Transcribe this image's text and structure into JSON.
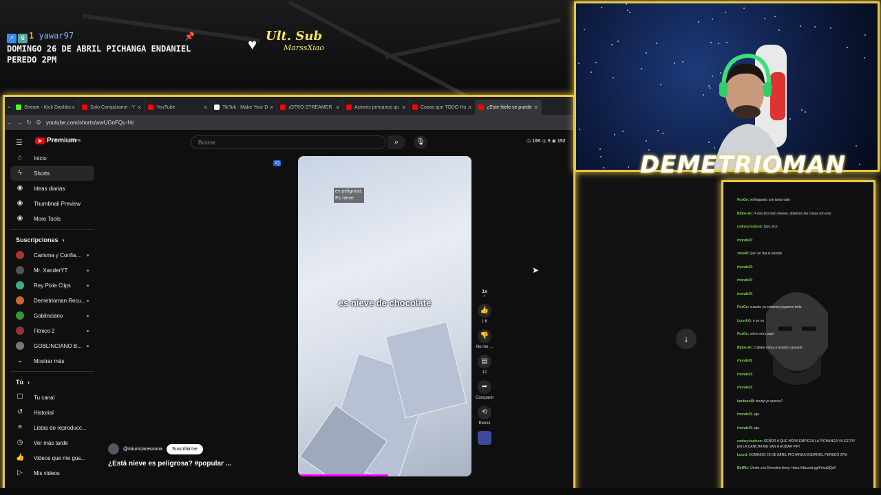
{
  "overlay": {
    "username": "yawar97",
    "badge_count": "1",
    "announcement": "DOMINGO 26 DE ABRIL PICHANGA ENDANIEL PEREDO 2PM",
    "ult_sub_label": "Ult. Sub",
    "ult_sub_name": "MarssXiao",
    "streamer_name": "DEMETRIOMAN"
  },
  "browser": {
    "tabs": [
      {
        "label": "Stream - Kick Dashbo",
        "color": "#53fc18"
      },
      {
        "label": "Solo Compárame - Y",
        "color": "#ff0000"
      },
      {
        "label": "YouTube",
        "color": "#ff0000"
      },
      {
        "label": "TikTok - Make Your D",
        "color": "#ffffff"
      },
      {
        "label": "¡OTRO STREAMER",
        "color": "#ff0000"
      },
      {
        "label": "Actores peruanos qu",
        "color": "#ff0000"
      },
      {
        "label": "Cosas que TODO Hu",
        "color": "#ff0000"
      },
      {
        "label": "¿Este hielo se puede",
        "color": "#ff0000"
      }
    ],
    "url": "youtube.com/shorts/wwUGnFQu-Hc"
  },
  "youtube": {
    "logo_text": "Premium",
    "logo_sup": "PE",
    "search_placeholder": "Buscar",
    "stats": {
      "views": "10K",
      "a": "5",
      "b": "152"
    },
    "nav": [
      {
        "label": "Inicio",
        "icon": "⌂"
      },
      {
        "label": "Shorts",
        "icon": "ϟ"
      },
      {
        "label": "Ideas diarias",
        "icon": "◉"
      },
      {
        "label": "Thumbnail Preview",
        "icon": "◉"
      },
      {
        "label": "More Tools",
        "icon": "◉"
      }
    ],
    "subs_header": "Suscripciones",
    "subscriptions": [
      {
        "label": "Carisma y Confia...",
        "color": "#a33"
      },
      {
        "label": "Mr. XanderYT",
        "color": "#555"
      },
      {
        "label": "Rey Pixie Clips",
        "color": "#4a8"
      },
      {
        "label": "Demetrioman Recu...",
        "color": "#c63"
      },
      {
        "label": "Goblinciano",
        "color": "#393"
      },
      {
        "label": "Fitnico 2",
        "color": "#933"
      },
      {
        "label": "GOBLINCIANO B...",
        "color": "#777"
      }
    ],
    "show_more": "Mostrar más",
    "you_header": "Tú",
    "you_items": [
      {
        "label": "Tu canal",
        "icon": "☐"
      },
      {
        "label": "Historial",
        "icon": "↺"
      },
      {
        "label": "Listas de reproducc...",
        "icon": "≡"
      },
      {
        "label": "Ver más tarde",
        "icon": "◷"
      },
      {
        "label": "Videos que me gus...",
        "icon": "👍"
      },
      {
        "label": "Mis videos",
        "icon": "▷"
      }
    ],
    "video": {
      "sub_line1": "es peligrosa.",
      "sub_line2": "Es nieve",
      "caption": "es nieve de chocolate",
      "channel": "@miunicaneurona",
      "subscribe": "Suscribirme",
      "title": "¿Está nieve es peligrosa? #popular ...",
      "progress": 0.52
    },
    "actions": {
      "speed": "1x",
      "likes": "1 K",
      "dislike": "No me ...",
      "comments": "12",
      "share": "Compartir",
      "remix": "Remix"
    }
  },
  "chat": {
    "lines": [
      {
        "user": "FosGe:",
        "text": "mi llegando con tanto odio"
      },
      {
        "user": "Bibbe-Ac:",
        "text": "4 eso bro todo meeee, dolemos las cosas con eso"
      },
      {
        "user": "rodney.hudson:",
        "text": "Que yico"
      },
      {
        "user": "rhondel3:",
        "text": ""
      },
      {
        "user": "zmo49:",
        "text": "Qun en dal el peredo"
      },
      {
        "user": "rhondel3:",
        "text": ""
      },
      {
        "user": "rhondel3:",
        "text": ""
      },
      {
        "user": "rhondel3:",
        "text": ""
      },
      {
        "user": "FosGe:",
        "text": "cuando ya estamos jugamos todo"
      },
      {
        "user": "Lourd-G:",
        "text": "o se va"
      },
      {
        "user": "FosGe:",
        "text": "cómo eres papi"
      },
      {
        "user": "Bibbe-Ac:",
        "text": "Cállate estoy a estado cansado"
      },
      {
        "user": "rhondel3:",
        "text": ""
      },
      {
        "user": "rhondel3:",
        "text": ""
      },
      {
        "user": "rhondel3:",
        "text": ""
      },
      {
        "user": "kardanz49:",
        "text": "brudy yo querás?"
      },
      {
        "user": "rhondel3:",
        "text": "jaja"
      },
      {
        "user": "rhondel3:",
        "text": "jaja"
      },
      {
        "user": "rodney.hudson:",
        "text": "SEÑOR A QUE HORA EMPIEZA LA PICHANGA YA ESTOY EN LA CANCHA ME VAN A ROBAR PIPI"
      },
      {
        "user": "Lourd:",
        "text": "DOMINGO 26 DE ABRIL PICHANGA ENDANIEL PEREDO 2PM"
      },
      {
        "user": "BotRix:",
        "text": "Únete a la Demetrio Army: https://discord.gg/hVuu5jQs6"
      }
    ]
  }
}
